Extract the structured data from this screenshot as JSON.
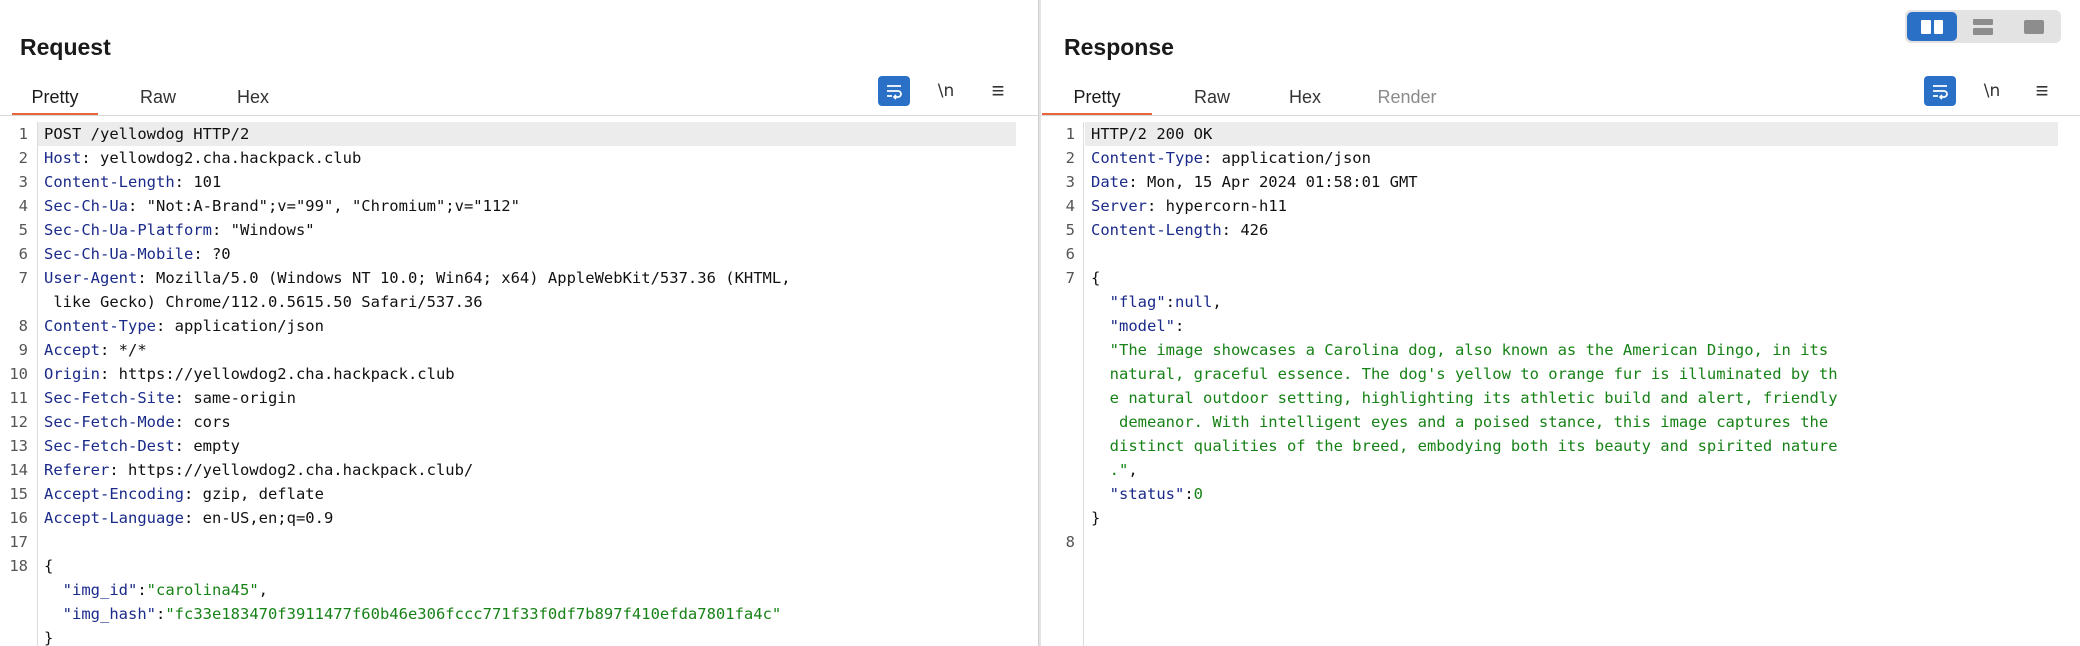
{
  "view_toggle": {
    "options": [
      "split-view-icon",
      "stacked-view-icon",
      "single-view-icon"
    ],
    "active": 0
  },
  "request": {
    "title": "Request",
    "tabs": [
      "Pretty",
      "Raw",
      "Hex"
    ],
    "active_tab": "Pretty",
    "tools": {
      "newline_label": "\\n",
      "menu_glyph": "≡"
    },
    "lines": [
      {
        "n": "1",
        "segs": [
          {
            "t": "POST /yellowdog HTTP/2",
            "c": "p"
          }
        ]
      },
      {
        "n": "2",
        "segs": [
          {
            "t": "Host",
            "c": "k"
          },
          {
            "t": ": yellowdog2.cha.hackpack.club",
            "c": "p"
          }
        ]
      },
      {
        "n": "3",
        "segs": [
          {
            "t": "Content-Length",
            "c": "k"
          },
          {
            "t": ": 101",
            "c": "p"
          }
        ]
      },
      {
        "n": "4",
        "segs": [
          {
            "t": "Sec-Ch-Ua",
            "c": "k"
          },
          {
            "t": ": \"Not:A-Brand\";v=\"99\", \"Chromium\";v=\"112\"",
            "c": "p"
          }
        ]
      },
      {
        "n": "5",
        "segs": [
          {
            "t": "Sec-Ch-Ua-Platform",
            "c": "k"
          },
          {
            "t": ": \"Windows\"",
            "c": "p"
          }
        ]
      },
      {
        "n": "6",
        "segs": [
          {
            "t": "Sec-Ch-Ua-Mobile",
            "c": "k"
          },
          {
            "t": ": ?0",
            "c": "p"
          }
        ]
      },
      {
        "n": "7",
        "segs": [
          {
            "t": "User-Agent",
            "c": "k"
          },
          {
            "t": ": Mozilla/5.0 (Windows NT 10.0; Win64; x64) AppleWebKit/537.36 (KHTML,",
            "c": "p"
          }
        ]
      },
      {
        "n": "",
        "segs": [
          {
            "t": " like Gecko) Chrome/112.0.5615.50 Safari/537.36",
            "c": "p"
          }
        ]
      },
      {
        "n": "8",
        "segs": [
          {
            "t": "Content-Type",
            "c": "k"
          },
          {
            "t": ": application/json",
            "c": "p"
          }
        ]
      },
      {
        "n": "9",
        "segs": [
          {
            "t": "Accept",
            "c": "k"
          },
          {
            "t": ": */*",
            "c": "p"
          }
        ]
      },
      {
        "n": "10",
        "segs": [
          {
            "t": "Origin",
            "c": "k"
          },
          {
            "t": ": https://yellowdog2.cha.hackpack.club",
            "c": "p"
          }
        ]
      },
      {
        "n": "11",
        "segs": [
          {
            "t": "Sec-Fetch-Site",
            "c": "k"
          },
          {
            "t": ": same-origin",
            "c": "p"
          }
        ]
      },
      {
        "n": "12",
        "segs": [
          {
            "t": "Sec-Fetch-Mode",
            "c": "k"
          },
          {
            "t": ": cors",
            "c": "p"
          }
        ]
      },
      {
        "n": "13",
        "segs": [
          {
            "t": "Sec-Fetch-Dest",
            "c": "k"
          },
          {
            "t": ": empty",
            "c": "p"
          }
        ]
      },
      {
        "n": "14",
        "segs": [
          {
            "t": "Referer",
            "c": "k"
          },
          {
            "t": ": https://yellowdog2.cha.hackpack.club/",
            "c": "p"
          }
        ]
      },
      {
        "n": "15",
        "segs": [
          {
            "t": "Accept-Encoding",
            "c": "k"
          },
          {
            "t": ": gzip, deflate",
            "c": "p"
          }
        ]
      },
      {
        "n": "16",
        "segs": [
          {
            "t": "Accept-Language",
            "c": "k"
          },
          {
            "t": ": en-US,en;q=0.9",
            "c": "p"
          }
        ]
      },
      {
        "n": "17",
        "segs": []
      },
      {
        "n": "18",
        "segs": [
          {
            "t": "{",
            "c": "p"
          }
        ]
      },
      {
        "n": "",
        "segs": [
          {
            "t": "  \"img_id\"",
            "c": "jk"
          },
          {
            "t": ":",
            "c": "p"
          },
          {
            "t": "\"carolina45\"",
            "c": "s"
          },
          {
            "t": ",",
            "c": "p"
          }
        ]
      },
      {
        "n": "",
        "segs": [
          {
            "t": "  \"img_hash\"",
            "c": "jk"
          },
          {
            "t": ":",
            "c": "p"
          },
          {
            "t": "\"fc33e183470f3911477f60b46e306fccc771f33f0df7b897f410efda7801fa4c\"",
            "c": "s"
          }
        ]
      },
      {
        "n": "",
        "segs": [
          {
            "t": "}",
            "c": "p"
          }
        ]
      }
    ]
  },
  "response": {
    "title": "Response",
    "tabs": [
      "Pretty",
      "Raw",
      "Hex",
      "Render"
    ],
    "active_tab": "Pretty",
    "tools": {
      "newline_label": "\\n",
      "menu_glyph": "≡"
    },
    "lines": [
      {
        "n": "1",
        "segs": [
          {
            "t": "HTTP/2 200 OK",
            "c": "p"
          }
        ]
      },
      {
        "n": "2",
        "segs": [
          {
            "t": "Content-Type",
            "c": "k"
          },
          {
            "t": ": application/json",
            "c": "p"
          }
        ]
      },
      {
        "n": "3",
        "segs": [
          {
            "t": "Date",
            "c": "k"
          },
          {
            "t": ": Mon, 15 Apr 2024 01:58:01 GMT",
            "c": "p"
          }
        ]
      },
      {
        "n": "4",
        "segs": [
          {
            "t": "Server",
            "c": "k"
          },
          {
            "t": ": hypercorn-h11",
            "c": "p"
          }
        ]
      },
      {
        "n": "5",
        "segs": [
          {
            "t": "Content-Length",
            "c": "k"
          },
          {
            "t": ": 426",
            "c": "p"
          }
        ]
      },
      {
        "n": "6",
        "segs": []
      },
      {
        "n": "7",
        "segs": [
          {
            "t": "{",
            "c": "p"
          }
        ]
      },
      {
        "n": "",
        "segs": [
          {
            "t": "  \"flag\"",
            "c": "jk"
          },
          {
            "t": ":",
            "c": "p"
          },
          {
            "t": "null",
            "c": "k"
          },
          {
            "t": ",",
            "c": "p"
          }
        ]
      },
      {
        "n": "",
        "segs": [
          {
            "t": "  \"model\"",
            "c": "jk"
          },
          {
            "t": ":",
            "c": "p"
          }
        ]
      },
      {
        "n": "",
        "segs": [
          {
            "t": "  \"The image showcases a Carolina dog, also known as the American Dingo, in its",
            "c": "s"
          }
        ]
      },
      {
        "n": "",
        "segs": [
          {
            "t": "  natural, graceful essence. The dog's yellow to orange fur is illuminated by th",
            "c": "s"
          }
        ]
      },
      {
        "n": "",
        "segs": [
          {
            "t": "  e natural outdoor setting, highlighting its athletic build and alert, friendly",
            "c": "s"
          }
        ]
      },
      {
        "n": "",
        "segs": [
          {
            "t": "   demeanor. With intelligent eyes and a poised stance, this image captures the",
            "c": "s"
          }
        ]
      },
      {
        "n": "",
        "segs": [
          {
            "t": "  distinct qualities of the breed, embodying both its beauty and spirited nature",
            "c": "s"
          }
        ]
      },
      {
        "n": "",
        "segs": [
          {
            "t": "  .\"",
            "c": "s"
          },
          {
            "t": ",",
            "c": "p"
          }
        ]
      },
      {
        "n": "",
        "segs": [
          {
            "t": "  \"status\"",
            "c": "jk"
          },
          {
            "t": ":",
            "c": "p"
          },
          {
            "t": "0",
            "c": "s"
          }
        ]
      },
      {
        "n": "",
        "segs": [
          {
            "t": "}",
            "c": "p"
          }
        ]
      },
      {
        "n": "8",
        "segs": []
      }
    ]
  }
}
